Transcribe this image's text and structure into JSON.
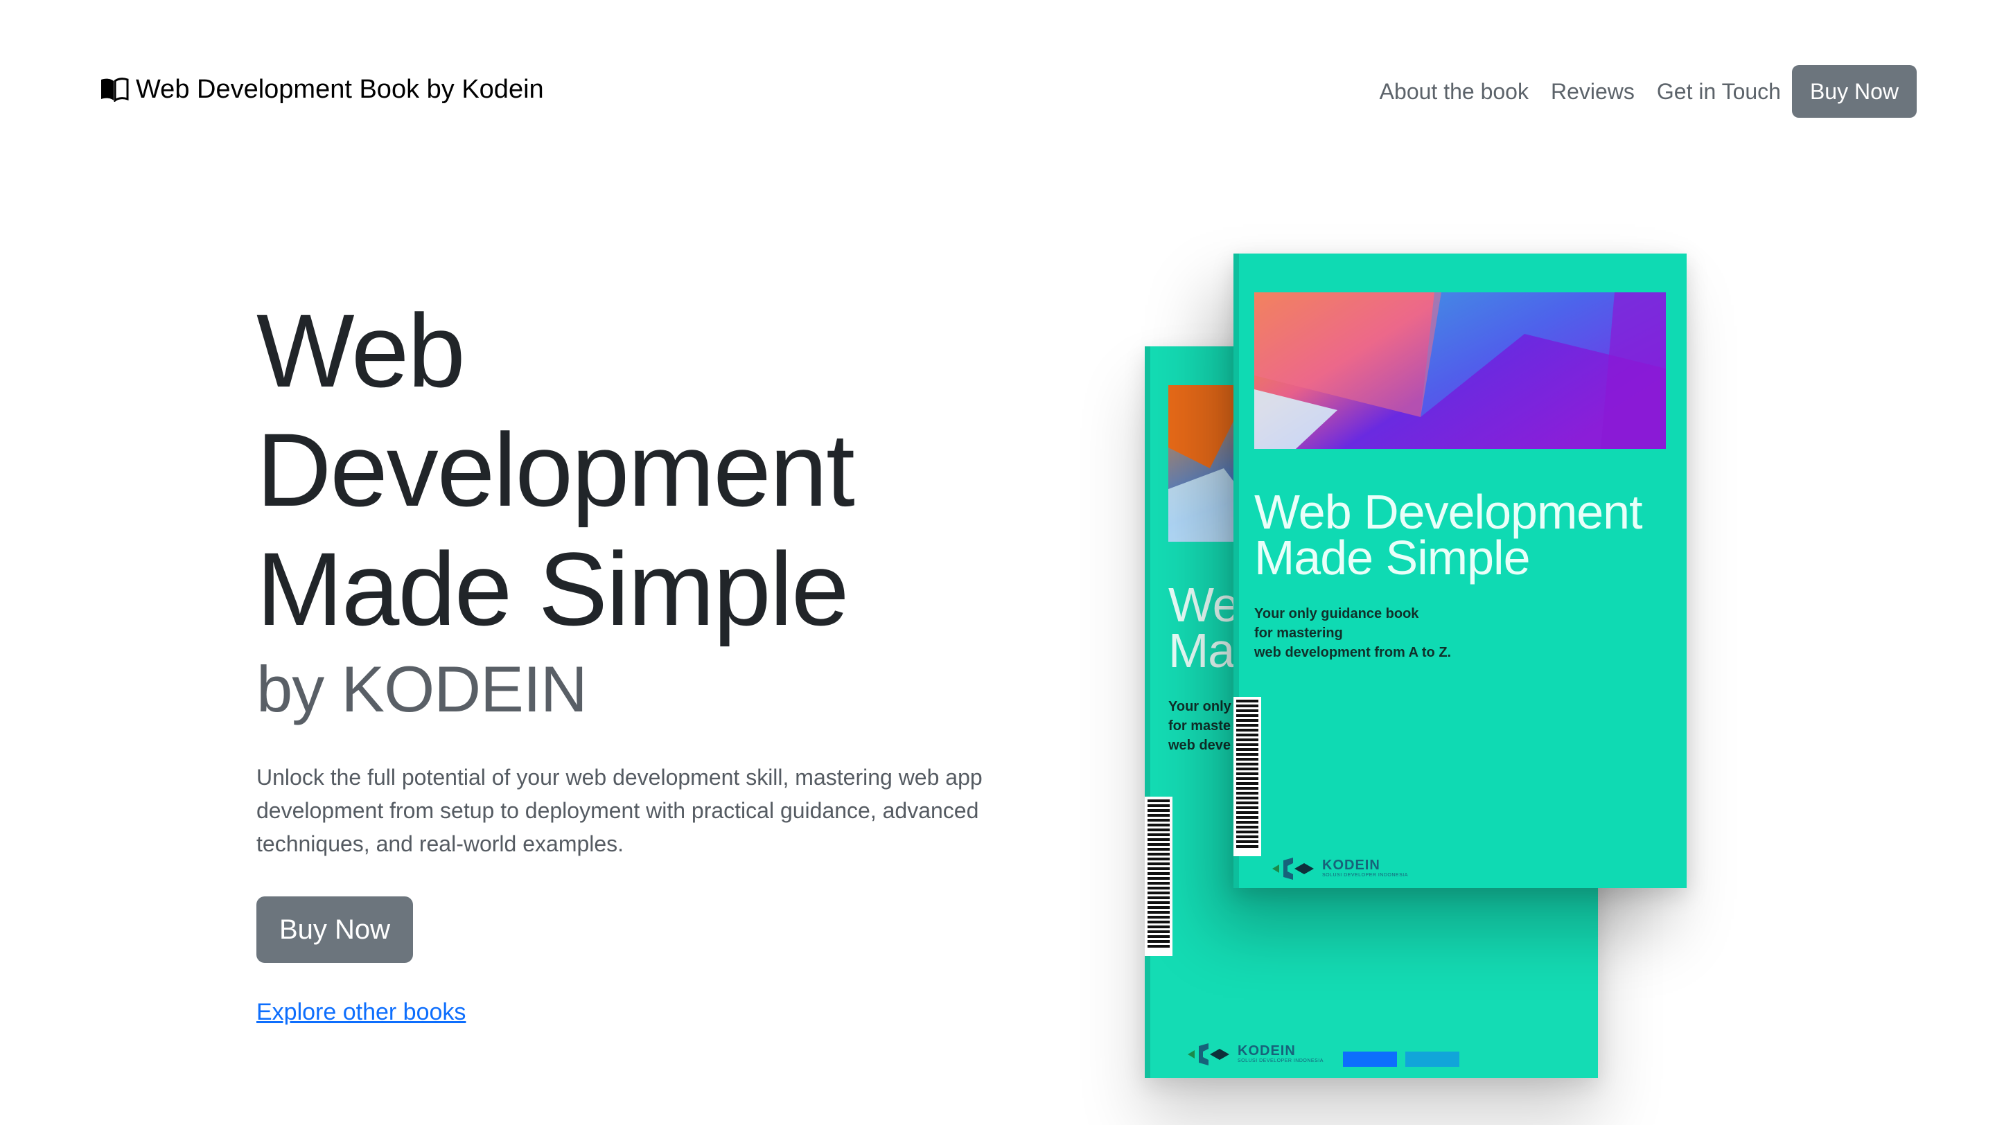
{
  "header": {
    "brand_icon": "book-icon",
    "brand": "Web Development Book by Kodein",
    "nav": [
      {
        "label": "About the book"
      },
      {
        "label": "Reviews"
      },
      {
        "label": "Get in Touch"
      }
    ],
    "buy_label": "Buy Now"
  },
  "hero": {
    "title_lines": [
      "Web",
      "Development",
      "Made Simple"
    ],
    "subtitle": "by KODEIN",
    "description": "Unlock the full potential of your web development skill, mastering web app development from setup to deployment with practical guidance, advanced techniques, and real-world examples.",
    "buy_label": "Buy Now",
    "explore_link": "Explore other books"
  },
  "book": {
    "cover_title_lines": [
      "Web Development",
      "Made Simple"
    ],
    "tagline_lines": [
      "Your only guidance book",
      "for mastering",
      "web development from A to Z."
    ],
    "back_title_lines": [
      "We",
      "Ma"
    ],
    "back_tagline_lines": [
      "Your only",
      "for maste",
      "web deve"
    ],
    "publisher": "KODEIN",
    "publisher_sub": "SOLUSI DEVELOPER INDONESIA"
  },
  "carousel": {
    "slide_count": 2,
    "active_index": 0
  },
  "colors": {
    "primary_button": "#6c757d",
    "link": "#0d6efd",
    "book_cover": "#0fdab3",
    "indicator": "#0d6efd"
  }
}
